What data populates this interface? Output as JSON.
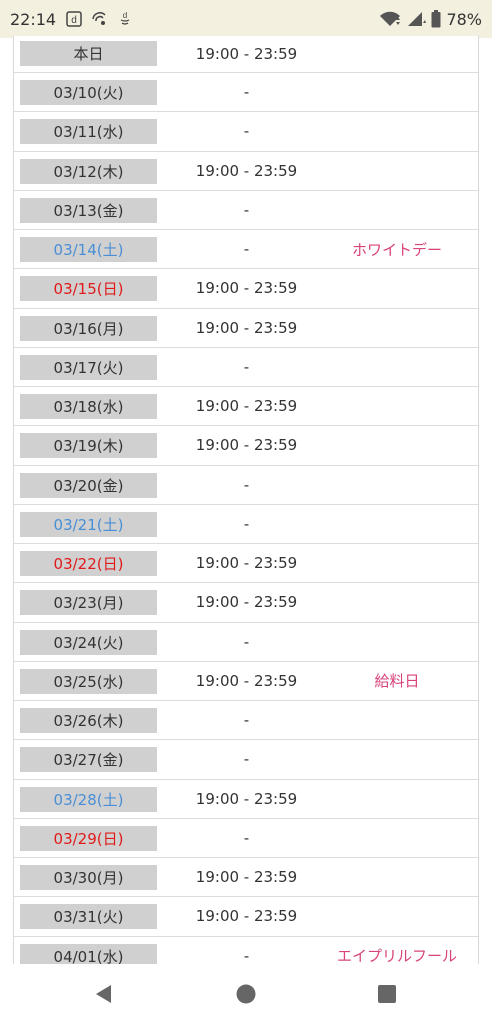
{
  "status_bar": {
    "time": "22:14",
    "battery_percent": "78%",
    "icons": [
      "d-icon",
      "roaming-icon",
      "d-logo-icon",
      "wifi-icon",
      "signal-icon",
      "battery-icon"
    ]
  },
  "colors": {
    "saturday": "#4a8fd6",
    "sunday": "#e01a1a",
    "event": "#d9437b",
    "date_bg": "#d0d0d0"
  },
  "rows": [
    {
      "date": "本日",
      "time": "19:00 - 23:59",
      "event": "",
      "type": "weekday"
    },
    {
      "date": "03/10(火)",
      "time": "-",
      "event": "",
      "type": "weekday"
    },
    {
      "date": "03/11(水)",
      "time": "-",
      "event": "",
      "type": "weekday"
    },
    {
      "date": "03/12(木)",
      "time": "19:00 - 23:59",
      "event": "",
      "type": "weekday"
    },
    {
      "date": "03/13(金)",
      "time": "-",
      "event": "",
      "type": "weekday"
    },
    {
      "date": "03/14(土)",
      "time": "-",
      "event": "ホワイトデー",
      "type": "sat"
    },
    {
      "date": "03/15(日)",
      "time": "19:00 - 23:59",
      "event": "",
      "type": "sun"
    },
    {
      "date": "03/16(月)",
      "time": "19:00 - 23:59",
      "event": "",
      "type": "weekday"
    },
    {
      "date": "03/17(火)",
      "time": "-",
      "event": "",
      "type": "weekday"
    },
    {
      "date": "03/18(水)",
      "time": "19:00 - 23:59",
      "event": "",
      "type": "weekday"
    },
    {
      "date": "03/19(木)",
      "time": "19:00 - 23:59",
      "event": "",
      "type": "weekday"
    },
    {
      "date": "03/20(金)",
      "time": "-",
      "event": "",
      "type": "weekday"
    },
    {
      "date": "03/21(土)",
      "time": "-",
      "event": "",
      "type": "sat"
    },
    {
      "date": "03/22(日)",
      "time": "19:00 - 23:59",
      "event": "",
      "type": "sun"
    },
    {
      "date": "03/23(月)",
      "time": "19:00 - 23:59",
      "event": "",
      "type": "weekday"
    },
    {
      "date": "03/24(火)",
      "time": "-",
      "event": "",
      "type": "weekday"
    },
    {
      "date": "03/25(水)",
      "time": "19:00 - 23:59",
      "event": "給料日",
      "type": "weekday"
    },
    {
      "date": "03/26(木)",
      "time": "-",
      "event": "",
      "type": "weekday"
    },
    {
      "date": "03/27(金)",
      "time": "-",
      "event": "",
      "type": "weekday"
    },
    {
      "date": "03/28(土)",
      "time": "19:00 - 23:59",
      "event": "",
      "type": "sat"
    },
    {
      "date": "03/29(日)",
      "time": "-",
      "event": "",
      "type": "sun"
    },
    {
      "date": "03/30(月)",
      "time": "19:00 - 23:59",
      "event": "",
      "type": "weekday"
    },
    {
      "date": "03/31(火)",
      "time": "19:00 - 23:59",
      "event": "",
      "type": "weekday"
    },
    {
      "date": "04/01(水)",
      "time": "-",
      "event": "エイプリルフール",
      "type": "weekday"
    }
  ],
  "nav": {
    "icons": [
      "back-icon",
      "home-icon",
      "recents-icon"
    ]
  }
}
